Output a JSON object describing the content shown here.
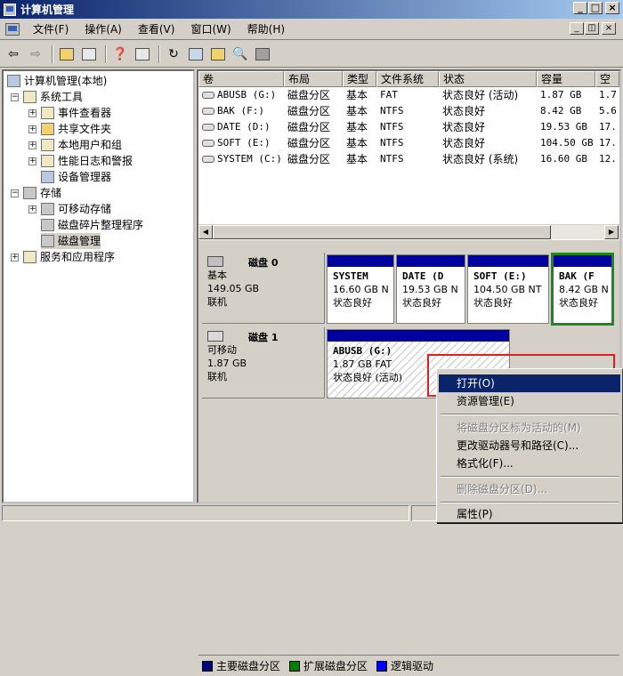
{
  "window": {
    "title": "计算机管理"
  },
  "menu": [
    "文件(F)",
    "操作(A)",
    "查看(V)",
    "窗口(W)",
    "帮助(H)"
  ],
  "tree": {
    "root": "计算机管理(本地)",
    "system_tools": "系统工具",
    "event_viewer": "事件查看器",
    "shared_folders": "共享文件夹",
    "local_users": "本地用户和组",
    "perf_logs": "性能日志和警报",
    "device_manager": "设备管理器",
    "storage": "存储",
    "removable": "可移动存储",
    "defrag": "磁盘碎片整理程序",
    "disk_mgmt": "磁盘管理",
    "services": "服务和应用程序"
  },
  "list": {
    "headers": [
      "卷",
      "布局",
      "类型",
      "文件系统",
      "状态",
      "容量",
      "空"
    ],
    "rows": [
      [
        "ABUSB (G:)",
        "磁盘分区",
        "基本",
        "FAT",
        "状态良好 (活动)",
        "1.87 GB",
        "1.7"
      ],
      [
        "BAK (F:)",
        "磁盘分区",
        "基本",
        "NTFS",
        "状态良好",
        "8.42 GB",
        "5.6"
      ],
      [
        "DATE (D:)",
        "磁盘分区",
        "基本",
        "NTFS",
        "状态良好",
        "19.53 GB",
        "17."
      ],
      [
        "SOFT (E:)",
        "磁盘分区",
        "基本",
        "NTFS",
        "状态良好",
        "104.50 GB",
        "17."
      ],
      [
        "SYSTEM (C:)",
        "磁盘分区",
        "基本",
        "NTFS",
        "状态良好 (系统)",
        "16.60 GB",
        "12."
      ]
    ]
  },
  "disks": [
    {
      "name": "磁盘 0",
      "type": "基本",
      "size": "149.05 GB",
      "status": "联机",
      "partitions": [
        {
          "name": "SYSTEM",
          "detail": "16.60 GB N",
          "status": "状态良好"
        },
        {
          "name": "DATE  (D",
          "detail": "19.53 GB N",
          "status": "状态良好"
        },
        {
          "name": "SOFT  (E:)",
          "detail": "104.50 GB NT",
          "status": "状态良好"
        },
        {
          "name": "BAK   (F",
          "detail": "8.42 GB  N",
          "status": "状态良好"
        }
      ]
    },
    {
      "name": "磁盘 1",
      "type": "可移动",
      "size": "1.87 GB",
      "status": "联机",
      "partitions": [
        {
          "name": "ABUSB  (G:)",
          "detail": "1.87 GB FAT",
          "status": "状态良好 (活动)"
        }
      ]
    }
  ],
  "legend": [
    "主要磁盘分区",
    "扩展磁盘分区",
    "逻辑驱动"
  ],
  "legend_colors": [
    "#000080",
    "#008000",
    "#0000ff"
  ],
  "context_menu": {
    "open": "打开(O)",
    "explore": "资源管理(E)",
    "mark_active": "将磁盘分区标为活动的(M)",
    "change_letter": "更改驱动器号和路径(C)...",
    "format": "格式化(F)...",
    "delete": "删除磁盘分区(D)...",
    "properties": "属性(P)"
  }
}
